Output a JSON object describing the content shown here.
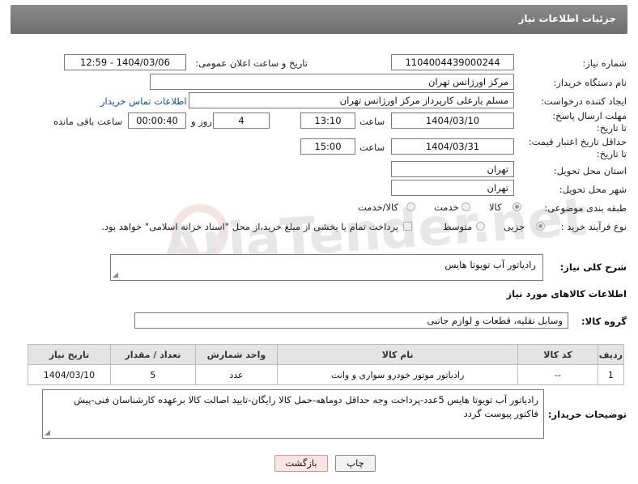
{
  "header": {
    "title": "جزئیات اطلاعات نیاز"
  },
  "watermark": {
    "text": "AriaTender.net"
  },
  "fields": {
    "need_number_label": "شماره نیاز:",
    "need_number": "1104004439000244",
    "announce_label": "تاریخ و ساعت اعلان عمومی:",
    "announce_value": "1404/03/06 - 12:59",
    "buyer_org_label": "نام دستگاه خریدار:",
    "buyer_org": "مرکز اورژانس تهران",
    "creator_label": "ایجاد کننده درخواست:",
    "creator": "مسلم یارعلی کارپرداز مرکز اورژانس تهران",
    "contact_link": "اطلاعات تماس خریدار",
    "deadline_label": "مهلت ارسال پاسخ: تا تاریخ:",
    "deadline_date": "1404/03/10",
    "time_label": "ساعت",
    "deadline_time": "13:10",
    "days_value": "4",
    "days_label": "روز و",
    "remaining_value": "00:00:40",
    "remaining_label": "ساعت باقی مانده",
    "validity_label": "حداقل تاریخ اعتبار قیمت: تا تاریخ:",
    "validity_date": "1404/03/31",
    "validity_time": "15:00",
    "province_label": "استان محل تحویل:",
    "province": "تهران",
    "city_label": "شهر محل تحویل:",
    "city": "تهران",
    "category_label": "طبقه بندی موضوعی:",
    "category_options": [
      "کالا",
      "خدمت",
      "کالا/خدمت"
    ],
    "process_label": "نوع فرآیند خرید :",
    "process_options": [
      "جزیی",
      "متوسط"
    ],
    "payment_note": "پرداخت تمام یا بخشی از مبلغ خرید،از محل \"اسناد خزانه اسلامی\" خواهد بود."
  },
  "description": {
    "label": "شرح کلی نیاز:",
    "value": "رادیاتور آب تویوتا هایس"
  },
  "goods_section": {
    "title": "اطلاعات کالاهای مورد نیاز"
  },
  "goods_group": {
    "label": "گروه کالا:",
    "value": "وسایل نقلیه، قطعات و لوازم جانبی"
  },
  "table": {
    "headers": [
      "ردیف",
      "کد کالا",
      "نام کالا",
      "واحد شمارش",
      "تعداد / مقدار",
      "تاریخ نیاز"
    ],
    "rows": [
      [
        "1",
        "--",
        "رادیاتور موتور خودرو سواری و وانت",
        "عدد",
        "5",
        "1404/03/10"
      ]
    ]
  },
  "buyer_notes": {
    "label": "توضیحات خریدار:",
    "value": "رادیاتور آب تویوتا هایس    5عدد-پرداخت وجه حداقل دوماهه-حمل کالا رایگان-تایید اصالت کالا برعهده کارشناسان فنی-پیش فاکتور پیوست گردد"
  },
  "buttons": {
    "print": "چاپ",
    "back": "بازگشت"
  }
}
